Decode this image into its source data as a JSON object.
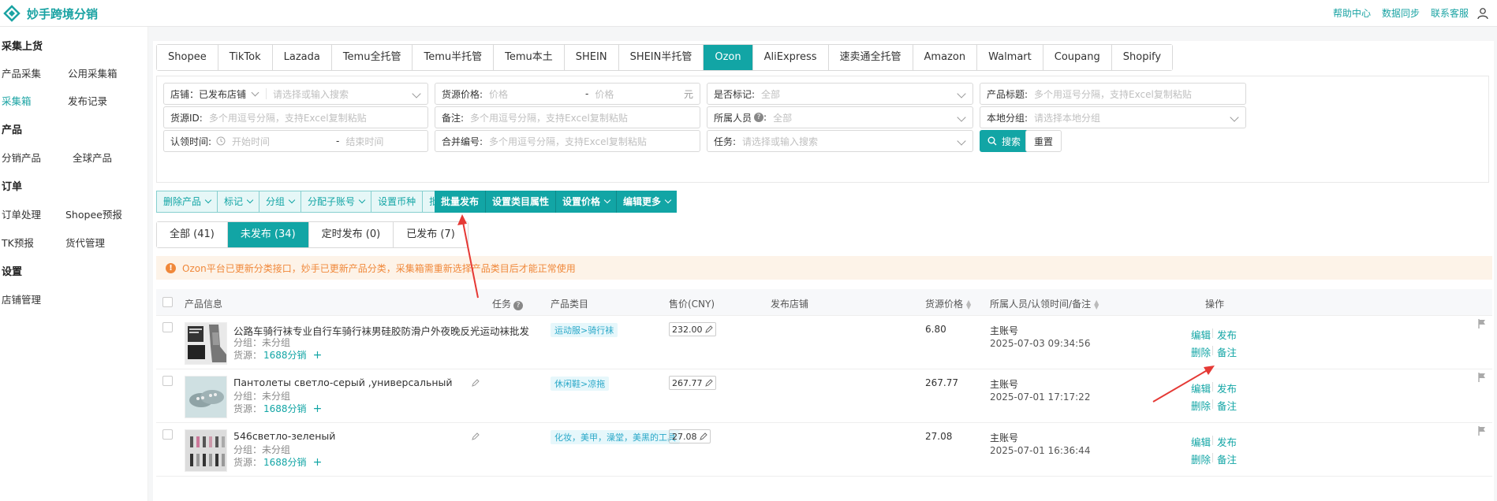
{
  "app": {
    "title": "妙手跨境分销",
    "brand_color": "#12a5a5",
    "links": [
      "帮助中心",
      "数据同步",
      "联系客服"
    ]
  },
  "sidebar": {
    "groups": [
      {
        "title": "采集上货",
        "items": [
          "产品采集",
          "公用采集箱",
          "采集箱",
          "发布记录"
        ]
      },
      {
        "title": "产品",
        "items": [
          "分销产品",
          "全球产品"
        ]
      },
      {
        "title": "订单",
        "items": [
          "订单处理",
          "Shopee预报",
          "TK预报",
          "货代管理"
        ]
      },
      {
        "title": "设置",
        "items": [
          "店铺管理"
        ]
      }
    ],
    "active": "采集箱"
  },
  "platform_tabs": [
    "Shopee",
    "TikTok",
    "Lazada",
    "Temu全托管",
    "Temu半托管",
    "Temu本土",
    "SHEIN",
    "SHEIN半托管",
    "Ozon",
    "AliExpress",
    "速卖通全托管",
    "Amazon",
    "Walmart",
    "Coupang",
    "Shopify"
  ],
  "platform_active": "Ozon",
  "filters": {
    "store_label": "店铺：已发布店铺",
    "store_placeholder": "请选择或输入搜索",
    "price_label": "货源价格:",
    "price_min": "价格",
    "price_dash": "-",
    "price_max": "价格",
    "price_unit": "元",
    "marked_label": "是否标记:",
    "marked_value": "全部",
    "title_label": "产品标题:",
    "title_placeholder": "多个用逗号分隔，支持Excel复制粘贴",
    "source_id_label": "货源ID:",
    "source_id_placeholder": "多个用逗号分隔，支持Excel复制粘贴",
    "remark_label": "备注:",
    "remark_placeholder": "多个用逗号分隔，支持Excel复制粘贴",
    "owner_label": "所属人员",
    "owner_value": "全部",
    "local_group_label": "本地分组:",
    "local_group_placeholder": "请选择本地分组",
    "claim_time_label": "认领时间:",
    "claim_start": "开始时间",
    "claim_dash": "-",
    "claim_end": "结束时间",
    "merge_label": "合并编号:",
    "merge_placeholder": "多个用逗号分隔，支持Excel复制粘贴",
    "task_label": "任务:",
    "task_placeholder": "请选择或输入搜索",
    "search_btn": "搜索",
    "reset_btn": "重置"
  },
  "actions_light": [
    "删除产品",
    "标记",
    "分组",
    "分配子账号",
    "设置币种",
    "批量备注"
  ],
  "actions_dark": [
    "批量发布",
    "设置类目属性",
    "设置价格",
    "编辑更多"
  ],
  "status_tabs": [
    "全部 (41)",
    "未发布 (34)",
    "定时发布 (0)",
    "已发布 (7)"
  ],
  "status_active": "未发布 (34)",
  "notice": "Ozon平台已更新分类接口，妙手已更新产品分类，采集箱需重新选择产品类目后才能正常使用",
  "table": {
    "headers": [
      "产品信息",
      "任务",
      "产品类目",
      "售价(CNY)",
      "发布店铺",
      "货源价格",
      "所属人员/认领时间/备注",
      "操作"
    ],
    "rows": [
      {
        "title": "公路车骑行袜专业自行车骑行袜男硅胶防滑户外夜晚反光运动袜批发",
        "group": "分组：未分组",
        "source_label": "货源：",
        "source": "1688分销",
        "category": "运动服>骑行袜",
        "price": "232.00",
        "src_price": "6.80",
        "owner": "主账号",
        "time": "2025-07-03 09:34:56",
        "ops": [
          "编辑",
          "发布",
          "删除",
          "备注"
        ]
      },
      {
        "title": "Пантолеты светло-серый ,универсальный",
        "group": "分组：未分组",
        "source_label": "货源：",
        "source": "1688分销",
        "category": "休闲鞋>凉拖",
        "price": "267.77",
        "src_price": "267.77",
        "owner": "主账号",
        "time": "2025-07-01 17:17:22",
        "ops": [
          "编辑",
          "发布",
          "删除",
          "备注"
        ]
      },
      {
        "title": "546светло-зеленый",
        "group": "分组：未分组",
        "source_label": "货源：",
        "source": "1688分销",
        "category": "化妆，美甲，澡堂，美黑的工具",
        "price": "27.08",
        "src_price": "27.08",
        "owner": "主账号",
        "time": "2025-07-01 16:36:44",
        "ops": [
          "编辑",
          "发布",
          "删除",
          "备注"
        ]
      }
    ]
  }
}
